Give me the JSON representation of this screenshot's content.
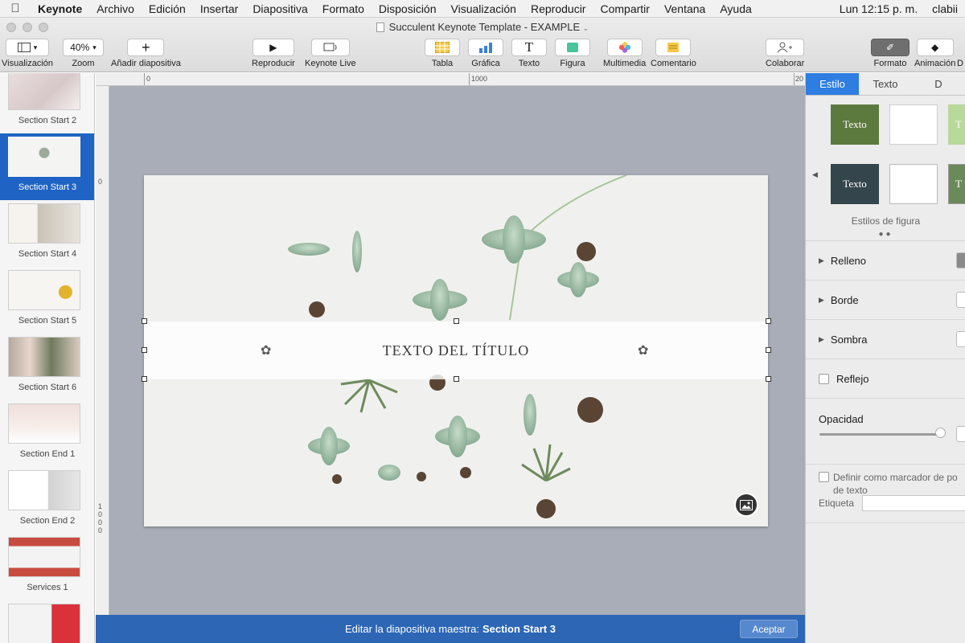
{
  "menubar": {
    "app": "Keynote",
    "items": [
      "Archivo",
      "Edición",
      "Insertar",
      "Diapositiva",
      "Formato",
      "Disposición",
      "Visualización",
      "Reproducir",
      "Compartir",
      "Ventana",
      "Ayuda"
    ],
    "clock": "Lun 12:15 p. m.",
    "user": "clabii"
  },
  "window": {
    "title": "Succulent Keynote Template - EXAMPLE"
  },
  "toolbar": {
    "view": "Visualización",
    "zoom": "Zoom",
    "zoom_value": "40%",
    "add_slide": "Añadir diapositiva",
    "play": "Reproducir",
    "keynote_live": "Keynote Live",
    "table": "Tabla",
    "chart": "Gráfica",
    "text": "Texto",
    "shape": "Figura",
    "media": "Multimedia",
    "comment": "Comentario",
    "collaborate": "Colaborar",
    "format": "Formato",
    "animate": "Animación",
    "document": "D"
  },
  "navigator": {
    "items": [
      {
        "label": "Section Start 2"
      },
      {
        "label": "Section Start 3"
      },
      {
        "label": "Section Start 4"
      },
      {
        "label": "Section Start 5"
      },
      {
        "label": "Section Start 6"
      },
      {
        "label": "Section End 1"
      },
      {
        "label": "Section End 2"
      },
      {
        "label": "Services 1"
      },
      {
        "label": ""
      }
    ],
    "selected_index": 1
  },
  "ruler": {
    "h_marks": [
      "0",
      "1000",
      "20"
    ],
    "v_marks": [
      "0",
      "1\n0\n0\n0"
    ]
  },
  "slide": {
    "title": "TEXTO DEL TÍTULO"
  },
  "editbar": {
    "text": "Editar la diapositiva maestra:",
    "slide_name": "Section Start 3",
    "accept": "Aceptar"
  },
  "inspector": {
    "tabs": [
      "Estilo",
      "Texto",
      "D"
    ],
    "style_swatches": [
      "Texto",
      "",
      "T",
      "Texto",
      "",
      "T"
    ],
    "styles_label": "Estilos de figura",
    "fill": "Relleno",
    "border": "Borde",
    "shadow": "Sombra",
    "reflection": "Reflejo",
    "opacity": "Opacidad",
    "opacity_value": 1.0,
    "placeholder_label": "Definir como marcador de posición de texto",
    "placeholder_line1": "Definir como marcador de po",
    "placeholder_line2": "de texto",
    "tag": "Etiqueta"
  },
  "colors": {
    "accent": "#2e7de1",
    "nav_selected": "#1f63c4",
    "editbar": "#2c66b5",
    "swatch_green": "#5d7a3e",
    "swatch_dark": "#34454b",
    "swatch_light_green": "#b8d99a"
  }
}
